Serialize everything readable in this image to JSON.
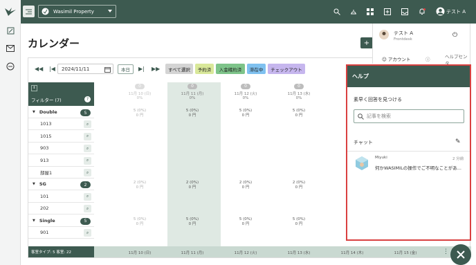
{
  "topbar": {
    "property": "Wasimil Property",
    "user": "テスト A"
  },
  "page": {
    "title": "カレンダー",
    "add": "+"
  },
  "toolbar": {
    "date": "2024/11/11",
    "today": "本日",
    "filters": [
      "すべて選択",
      "予約済",
      "入金確約済",
      "滞在中",
      "チェックアウト"
    ]
  },
  "grid": {
    "filter_label": "フィルター (7)",
    "columns": [
      {
        "count": "0",
        "date": "11月 10 (日)",
        "rate": "0%"
      },
      {
        "count": "0",
        "date": "11月 11 (月)",
        "rate": "0%"
      },
      {
        "count": "0",
        "date": "11月 12 (火)",
        "rate": "0%"
      },
      {
        "count": "0",
        "date": "11月 13 (水)",
        "rate": "0%"
      }
    ],
    "rows": [
      {
        "label": "Double",
        "group": true,
        "badge": "5",
        "cells": [
          "5 (0%)\n0 円",
          "5 (0%)\n0 円",
          "5 (0%)\n0 円",
          "5 (0%)\n0 円"
        ]
      },
      {
        "label": "1013"
      },
      {
        "label": "1015"
      },
      {
        "label": "903"
      },
      {
        "label": "913"
      },
      {
        "label": "部屋1"
      },
      {
        "label": "SG",
        "group": true,
        "badge": "2",
        "cells": [
          "2 (0%)\n0 円",
          "2 (0%)\n0 円",
          "2 (0%)\n0 円",
          "2 (0%)\n0 円"
        ]
      },
      {
        "label": "101"
      },
      {
        "label": "202"
      },
      {
        "label": "Single",
        "group": true,
        "badge": "5",
        "cells": [
          "5 (0%)\n0 円",
          "5 (0%)\n0 円",
          "5 (0%)\n0 円",
          "5 (0%)\n0 円"
        ]
      },
      {
        "label": "901"
      }
    ],
    "footer_summary": "客室タイプ: 5 客室: 22",
    "footer_dates": [
      "11月 10 (日)",
      "11月 11 (月)",
      "11月 12 (火)",
      "11月 13 (水)",
      "11月 14 (木)",
      "11月 15 (金)"
    ]
  },
  "user_menu": {
    "name": "テスト A",
    "role": "Frontdesk",
    "account": "アカウント",
    "help_center": "ヘルプセンタ"
  },
  "help": {
    "title": "ヘルプ",
    "find_answers": "素早く回答を見つける",
    "search_placeholder": "記事を検索",
    "chat_label": "チャット",
    "message": {
      "sender": "Miyuki",
      "time": "2 分前",
      "text": "何かWASIMILの操作でご不明なことがあ..."
    }
  },
  "colors": {
    "brand": "#3d5a50",
    "highlight": "#d94040"
  }
}
